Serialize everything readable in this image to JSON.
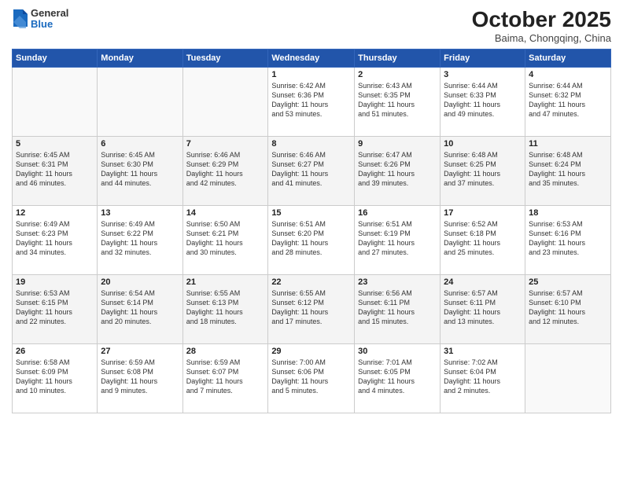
{
  "header": {
    "logo": {
      "general": "General",
      "blue": "Blue"
    },
    "title": "October 2025",
    "location": "Baima, Chongqing, China"
  },
  "days_of_week": [
    "Sunday",
    "Monday",
    "Tuesday",
    "Wednesday",
    "Thursday",
    "Friday",
    "Saturday"
  ],
  "weeks": [
    [
      {
        "day": "",
        "info": ""
      },
      {
        "day": "",
        "info": ""
      },
      {
        "day": "",
        "info": ""
      },
      {
        "day": "1",
        "info": "Sunrise: 6:42 AM\nSunset: 6:36 PM\nDaylight: 11 hours\nand 53 minutes."
      },
      {
        "day": "2",
        "info": "Sunrise: 6:43 AM\nSunset: 6:35 PM\nDaylight: 11 hours\nand 51 minutes."
      },
      {
        "day": "3",
        "info": "Sunrise: 6:44 AM\nSunset: 6:33 PM\nDaylight: 11 hours\nand 49 minutes."
      },
      {
        "day": "4",
        "info": "Sunrise: 6:44 AM\nSunset: 6:32 PM\nDaylight: 11 hours\nand 47 minutes."
      }
    ],
    [
      {
        "day": "5",
        "info": "Sunrise: 6:45 AM\nSunset: 6:31 PM\nDaylight: 11 hours\nand 46 minutes."
      },
      {
        "day": "6",
        "info": "Sunrise: 6:45 AM\nSunset: 6:30 PM\nDaylight: 11 hours\nand 44 minutes."
      },
      {
        "day": "7",
        "info": "Sunrise: 6:46 AM\nSunset: 6:29 PM\nDaylight: 11 hours\nand 42 minutes."
      },
      {
        "day": "8",
        "info": "Sunrise: 6:46 AM\nSunset: 6:27 PM\nDaylight: 11 hours\nand 41 minutes."
      },
      {
        "day": "9",
        "info": "Sunrise: 6:47 AM\nSunset: 6:26 PM\nDaylight: 11 hours\nand 39 minutes."
      },
      {
        "day": "10",
        "info": "Sunrise: 6:48 AM\nSunset: 6:25 PM\nDaylight: 11 hours\nand 37 minutes."
      },
      {
        "day": "11",
        "info": "Sunrise: 6:48 AM\nSunset: 6:24 PM\nDaylight: 11 hours\nand 35 minutes."
      }
    ],
    [
      {
        "day": "12",
        "info": "Sunrise: 6:49 AM\nSunset: 6:23 PM\nDaylight: 11 hours\nand 34 minutes."
      },
      {
        "day": "13",
        "info": "Sunrise: 6:49 AM\nSunset: 6:22 PM\nDaylight: 11 hours\nand 32 minutes."
      },
      {
        "day": "14",
        "info": "Sunrise: 6:50 AM\nSunset: 6:21 PM\nDaylight: 11 hours\nand 30 minutes."
      },
      {
        "day": "15",
        "info": "Sunrise: 6:51 AM\nSunset: 6:20 PM\nDaylight: 11 hours\nand 28 minutes."
      },
      {
        "day": "16",
        "info": "Sunrise: 6:51 AM\nSunset: 6:19 PM\nDaylight: 11 hours\nand 27 minutes."
      },
      {
        "day": "17",
        "info": "Sunrise: 6:52 AM\nSunset: 6:18 PM\nDaylight: 11 hours\nand 25 minutes."
      },
      {
        "day": "18",
        "info": "Sunrise: 6:53 AM\nSunset: 6:16 PM\nDaylight: 11 hours\nand 23 minutes."
      }
    ],
    [
      {
        "day": "19",
        "info": "Sunrise: 6:53 AM\nSunset: 6:15 PM\nDaylight: 11 hours\nand 22 minutes."
      },
      {
        "day": "20",
        "info": "Sunrise: 6:54 AM\nSunset: 6:14 PM\nDaylight: 11 hours\nand 20 minutes."
      },
      {
        "day": "21",
        "info": "Sunrise: 6:55 AM\nSunset: 6:13 PM\nDaylight: 11 hours\nand 18 minutes."
      },
      {
        "day": "22",
        "info": "Sunrise: 6:55 AM\nSunset: 6:12 PM\nDaylight: 11 hours\nand 17 minutes."
      },
      {
        "day": "23",
        "info": "Sunrise: 6:56 AM\nSunset: 6:11 PM\nDaylight: 11 hours\nand 15 minutes."
      },
      {
        "day": "24",
        "info": "Sunrise: 6:57 AM\nSunset: 6:11 PM\nDaylight: 11 hours\nand 13 minutes."
      },
      {
        "day": "25",
        "info": "Sunrise: 6:57 AM\nSunset: 6:10 PM\nDaylight: 11 hours\nand 12 minutes."
      }
    ],
    [
      {
        "day": "26",
        "info": "Sunrise: 6:58 AM\nSunset: 6:09 PM\nDaylight: 11 hours\nand 10 minutes."
      },
      {
        "day": "27",
        "info": "Sunrise: 6:59 AM\nSunset: 6:08 PM\nDaylight: 11 hours\nand 9 minutes."
      },
      {
        "day": "28",
        "info": "Sunrise: 6:59 AM\nSunset: 6:07 PM\nDaylight: 11 hours\nand 7 minutes."
      },
      {
        "day": "29",
        "info": "Sunrise: 7:00 AM\nSunset: 6:06 PM\nDaylight: 11 hours\nand 5 minutes."
      },
      {
        "day": "30",
        "info": "Sunrise: 7:01 AM\nSunset: 6:05 PM\nDaylight: 11 hours\nand 4 minutes."
      },
      {
        "day": "31",
        "info": "Sunrise: 7:02 AM\nSunset: 6:04 PM\nDaylight: 11 hours\nand 2 minutes."
      },
      {
        "day": "",
        "info": ""
      }
    ]
  ]
}
